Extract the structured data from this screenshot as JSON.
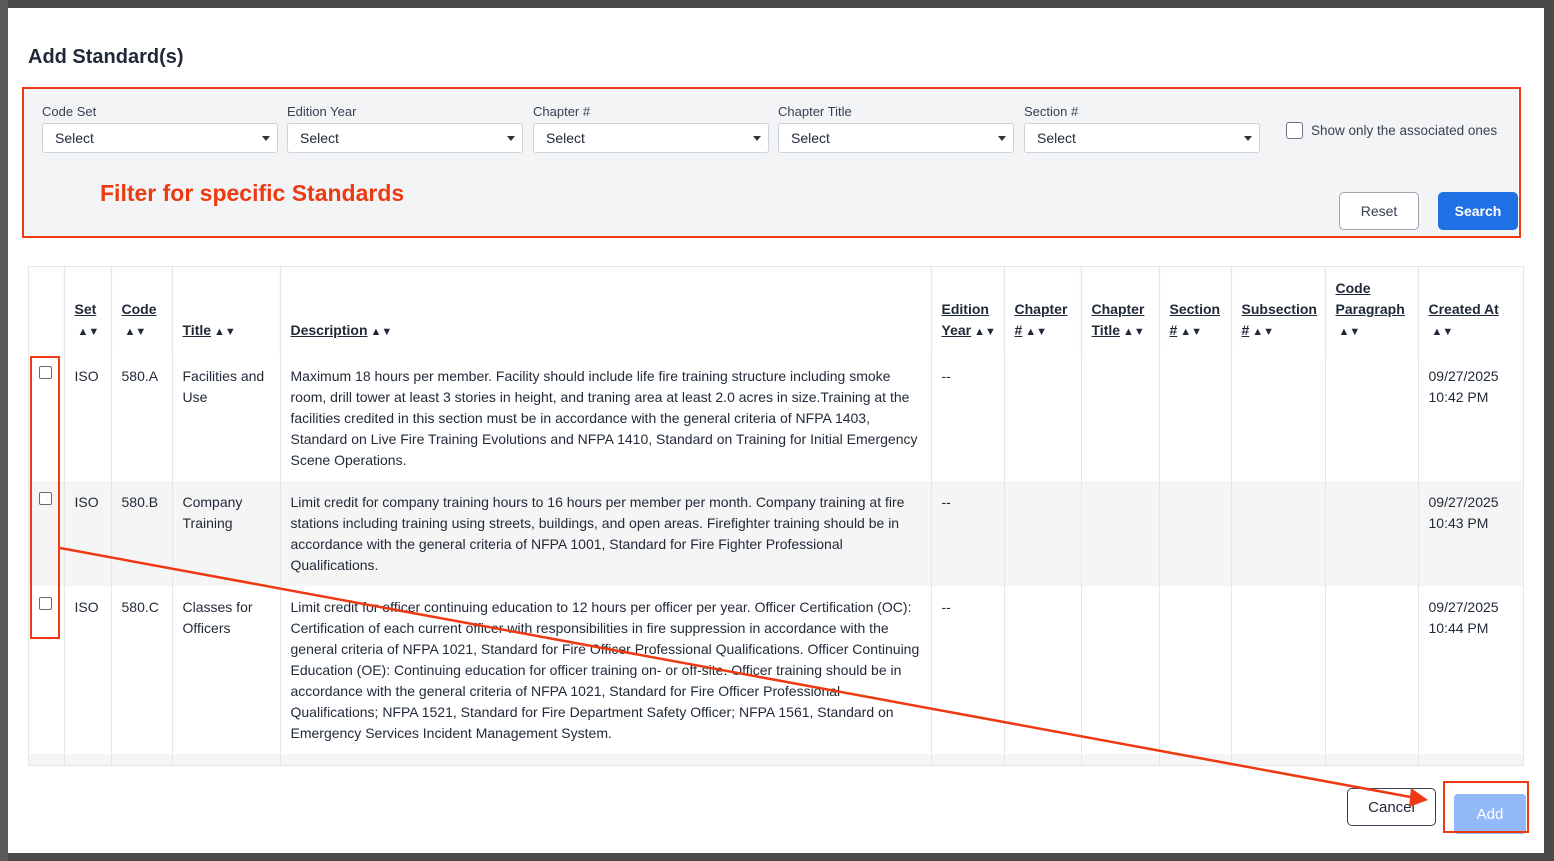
{
  "modal": {
    "title": "Add Standard(s)"
  },
  "filters": {
    "code_set": {
      "label": "Code Set",
      "value": "Select"
    },
    "edition_year": {
      "label": "Edition Year",
      "value": "Select"
    },
    "chapter_num": {
      "label": "Chapter #",
      "value": "Select"
    },
    "chapter_title": {
      "label": "Chapter Title",
      "value": "Select"
    },
    "section_num": {
      "label": "Section #",
      "value": "Select"
    },
    "associated_only_label": "Show only the associated ones",
    "reset_label": "Reset",
    "search_label": "Search"
  },
  "annotation": {
    "filter_note": "Filter for specific Standards",
    "color": "#ee3a12"
  },
  "table": {
    "headers": {
      "set": "Set",
      "code": "Code",
      "title": "Title",
      "description": "Description",
      "edition_year": "Edition Year",
      "chapter_num": "Chapter #",
      "chapter_title": "Chapter Title",
      "section_num": "Section #",
      "subsection_num": "Subsection #",
      "code_paragraph": "Code Paragraph",
      "created_at": "Created At"
    },
    "rows": [
      {
        "set": "ISO",
        "code": "580.A",
        "title": "Facilities and Use",
        "description": "Maximum 18 hours per member. Facility should include life fire training structure including smoke room, drill tower at least 3 stories in height, and traning area at least 2.0 acres in size.Training at the facilities credited in this section must be in accordance with the general criteria of NFPA 1403, Standard on Live Fire Training Evolutions and NFPA 1410, Standard on Training for Initial Emergency Scene Operations.",
        "edition_year": "--",
        "created_date": "09/27/2025",
        "created_time": "10:42 PM"
      },
      {
        "set": "ISO",
        "code": "580.B",
        "title": "Company Training",
        "description": "Limit credit for company training hours to 16 hours per member per month. Company training at fire stations including training using streets, buildings, and open areas. Firefighter training should be in accordance with the general criteria of NFPA 1001, Standard for Fire Fighter Professional Qualifications.",
        "edition_year": "--",
        "created_date": "09/27/2025",
        "created_time": "10:43 PM"
      },
      {
        "set": "ISO",
        "code": "580.C",
        "title": "Classes for Officers",
        "description": "Limit credit for officer continuing education to 12 hours per officer per year. Officer Certification (OC): Certification of each current officer with responsibilities in fire suppression in accordance with the general criteria of NFPA 1021, Standard for Fire Officer Professional Qualifications. Officer Continuing Education (OE): Continuing education for officer training on- or off-site. Officer training should be in accordance with the general criteria of NFPA 1021, Standard for Fire Officer Professional Qualifications; NFPA 1521, Standard for Fire Department Safety Officer; NFPA 1561, Standard on Emergency Services Incident Management System.",
        "edition_year": "--",
        "created_date": "09/27/2025",
        "created_time": "10:44 PM"
      }
    ]
  },
  "footer": {
    "cancel_label": "Cancel",
    "add_label": "Add"
  },
  "colors": {
    "primary": "#1f6fe5",
    "add_disabled": "#93b9f8",
    "annotation": "#ee3a12"
  }
}
